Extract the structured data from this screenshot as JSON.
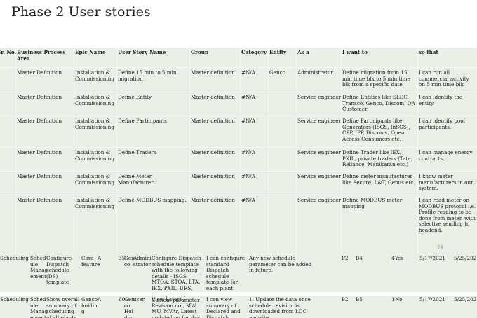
{
  "page_title": "Phase 2 User stories",
  "headers": {
    "sr_no": "Sr. No.",
    "business_process_area": "Business Process Area",
    "epic_name": "Epic Name",
    "user_story_name": "User Story Name",
    "group": "Group",
    "category": "Category",
    "entity": "Entity",
    "as_a": "As a",
    "i_want_to": "I want to",
    "so_that": "so that"
  },
  "rows": [
    {
      "bpa": "Master Definition",
      "epic": "Installation & Commissioning",
      "story": "Define 15 min to 5 min migration",
      "group": "Master definition",
      "category": "#N/A",
      "entity": "Genco",
      "as_a": "Administrator",
      "want": "Define migration from 15 min time blk to 5 min time blk from a specific date",
      "so_that": "I can run all commercial activity on 5 min time blk"
    },
    {
      "bpa": "Master Definition",
      "epic": "Installation & Commissioning",
      "story": "Define Entity",
      "group": "Master definition",
      "category": "#N/A",
      "entity": "",
      "as_a": "Service engineer",
      "want": "Define Entities like SLDC, Transco, Genco, Discom, OA Customer",
      "so_that": "I can identify the entity."
    },
    {
      "bpa": "Master Definition",
      "epic": "Installation & Commissioning",
      "story": "Define Participants",
      "group": "Master definition",
      "category": "#N/A",
      "entity": "",
      "as_a": "Service engineer",
      "want": "Define Participants like Generators (ISGS, InSGS), CPP, IPP, Discoms, Open Access Consumers etc.",
      "so_that": "I can identify pool participants."
    },
    {
      "bpa": "Master Definition",
      "epic": "Installation & Commissioning",
      "story": "Define Traders",
      "group": "Master definition",
      "category": "#N/A",
      "entity": "",
      "as_a": "Service engineer",
      "want": "Define Trader like IEX, PXIL, private traders (Tata, Reliance, Manikaran etc.)",
      "so_that": "I can manage energy contracts."
    },
    {
      "bpa": "Master Definition",
      "epic": "Installation & Commissioning",
      "story": "Define Meter Manufacturer",
      "group": "Master definition",
      "category": "#N/A",
      "entity": "",
      "as_a": "Service engineer",
      "want": "Define meter manufacturer like Secure, L&T, Genus etc.",
      "so_that": "I know meter manufacturers in our system."
    },
    {
      "bpa": "Master Definition",
      "epic": "Installation & Commissioning",
      "story": "Define MODBUS mapping.",
      "group": "Master definition",
      "category": "#N/A",
      "entity": "",
      "as_a": "Service engineer",
      "want": "Define MODBUS meter mapping",
      "so_that": "I can read meter on MODBUS protocol i.e. Profile reading to be done from meter, with selective sending to headend."
    }
  ],
  "page_number": "24",
  "lower_rows": [
    {
      "c1": "Scheduling",
      "c2": "Sched ule Manag ement",
      "c3": "Configure Dispatch schedule (DS) template",
      "c4": "Core feature",
      "c5": "A",
      "c6": "35",
      "c7": "Gen co",
      "c8": "Admini strator",
      "c9": "Configure Dispatch schedule template with the following details - ISGS, MTOA, STOA, LTA, IEX, PXIL, URS, RRAS, SCED, Custom parameter",
      "c10": "I can configure standard Dispatch schedule template for each plant",
      "c11": "Any new schedule parameter can be added in future.",
      "c12": "P2",
      "c13": "B4",
      "c14": "4",
      "c15": "Yes",
      "c16": "5/17/2021",
      "c17": "5/25/2021"
    },
    {
      "c1": "Scheduling",
      "c2": "Sched ule Manag ement",
      "c3": "Show overall summary of scheduling of all plants",
      "c4": "Genco holdin g",
      "c5": "A",
      "c6": "60",
      "c7": "Gen co Hol din",
      "c8": "user",
      "c9": "View Latest Revision no., MW, MU, MVAr, Latest updated on for day ahead and intra-day",
      "c10": "I can view summary of Declared and Dispatch",
      "c11": "1. Update the data once schedule revision is downloaded from LDC website",
      "c12": "P2",
      "c13": "B5",
      "c14": "1",
      "c15": "No",
      "c16": "5/17/2021",
      "c17": "5/25/2021"
    }
  ]
}
